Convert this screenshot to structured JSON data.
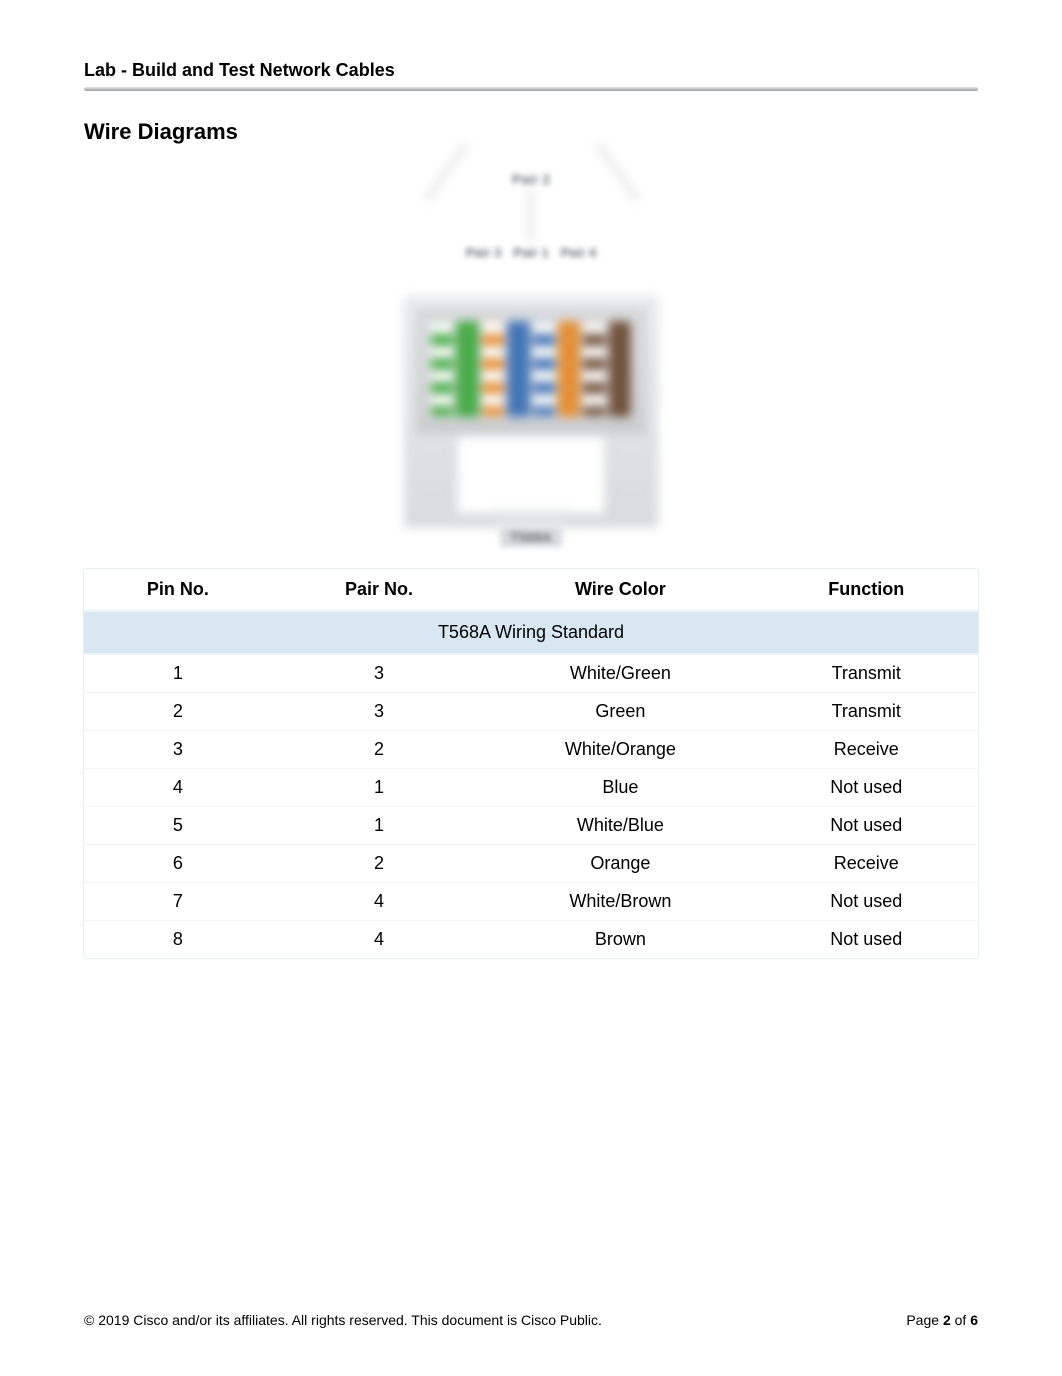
{
  "doc": {
    "title": "Lab - Build and Test Network Cables",
    "section_heading": "Wire Diagrams",
    "copyright": "© 2019 Cisco and/or its affiliates. All rights reserved. This document is Cisco Public.",
    "page_prefix": "Page ",
    "page_current": "2",
    "page_sep": " of ",
    "page_total": "6"
  },
  "diagram": {
    "top_label": "Pair 2",
    "mid_labels": [
      "Pair 3",
      "Pair 1",
      "Pair 4"
    ],
    "bottom_label": "T568A",
    "wire_colors": [
      {
        "type": "stripe",
        "color": "#3fa83f"
      },
      {
        "type": "solid",
        "color": "#3fa83f"
      },
      {
        "type": "stripe",
        "color": "#e58a2b"
      },
      {
        "type": "solid",
        "color": "#3a6fb5"
      },
      {
        "type": "stripe",
        "color": "#3a6fb5"
      },
      {
        "type": "solid",
        "color": "#e58a2b"
      },
      {
        "type": "stripe",
        "color": "#6a4a33"
      },
      {
        "type": "solid",
        "color": "#6a4a33"
      }
    ]
  },
  "table": {
    "title": "T568A Wiring Standard",
    "headers": {
      "pin": "Pin No.",
      "pair": "Pair No.",
      "color": "Wire Color",
      "function": "Function"
    },
    "rows": [
      {
        "pin": "1",
        "pair": "3",
        "color": "White/Green",
        "function": "Transmit"
      },
      {
        "pin": "2",
        "pair": "3",
        "color": "Green",
        "function": "Transmit"
      },
      {
        "pin": "3",
        "pair": "2",
        "color": "White/Orange",
        "function": "Receive"
      },
      {
        "pin": "4",
        "pair": "1",
        "color": "Blue",
        "function": "Not used"
      },
      {
        "pin": "5",
        "pair": "1",
        "color": "White/Blue",
        "function": "Not used"
      },
      {
        "pin": "6",
        "pair": "2",
        "color": "Orange",
        "function": "Receive"
      },
      {
        "pin": "7",
        "pair": "4",
        "color": "White/Brown",
        "function": "Not used"
      },
      {
        "pin": "8",
        "pair": "4",
        "color": "Brown",
        "function": "Not used"
      }
    ]
  },
  "chart_data": {
    "type": "table",
    "title": "T568A Wiring Standard",
    "columns": [
      "Pin No.",
      "Pair No.",
      "Wire Color",
      "Function"
    ],
    "rows": [
      [
        1,
        3,
        "White/Green",
        "Transmit"
      ],
      [
        2,
        3,
        "Green",
        "Transmit"
      ],
      [
        3,
        2,
        "White/Orange",
        "Receive"
      ],
      [
        4,
        1,
        "Blue",
        "Not used"
      ],
      [
        5,
        1,
        "White/Blue",
        "Not used"
      ],
      [
        6,
        2,
        "Orange",
        "Receive"
      ],
      [
        7,
        4,
        "White/Brown",
        "Not used"
      ],
      [
        8,
        4,
        "Brown",
        "Not used"
      ]
    ]
  }
}
